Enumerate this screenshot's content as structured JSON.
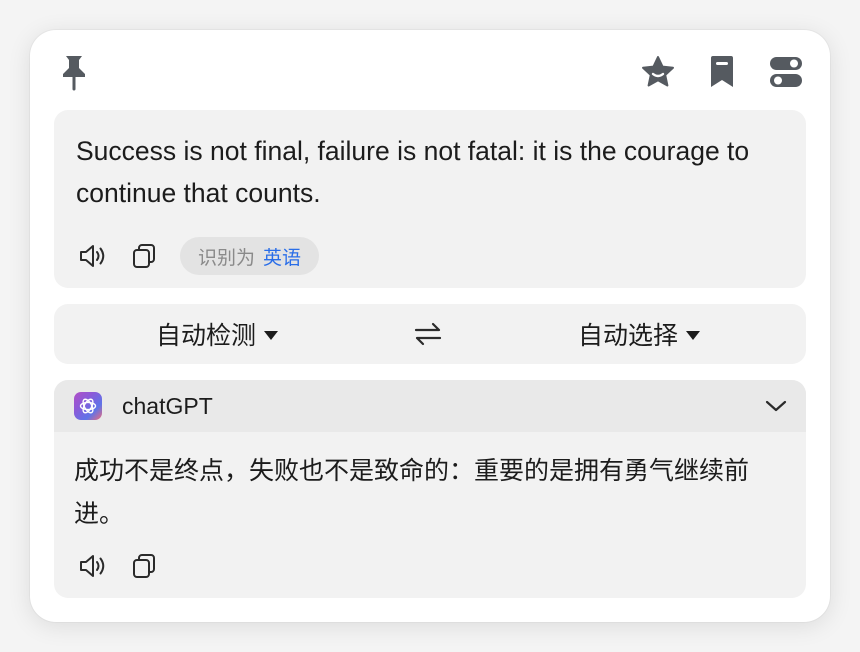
{
  "toolbar": {
    "icons": [
      "pin-icon",
      "star-icon",
      "bookmark-icon",
      "toggles-icon"
    ]
  },
  "source": {
    "text": "Success is not final, failure is not fatal: it is the courage to continue that counts.",
    "detected_prefix": "识别为",
    "detected_language": "英语",
    "icons": [
      "speaker-icon",
      "copy-icon"
    ]
  },
  "languages": {
    "from": "自动检测",
    "to": "自动选择",
    "swap_icon": "swap-arrows-icon"
  },
  "result": {
    "engine": "chatGPT",
    "engine_icon": "openai-logo-icon",
    "text": "成功不是终点，失败也不是致命的：重要的是拥有勇气继续前进。",
    "icons": [
      "speaker-icon",
      "copy-icon",
      "chevron-down-icon"
    ]
  },
  "colors": {
    "accent": "#2a6ee8",
    "card_bg": "#f2f2f2",
    "icon": "#555a60"
  }
}
